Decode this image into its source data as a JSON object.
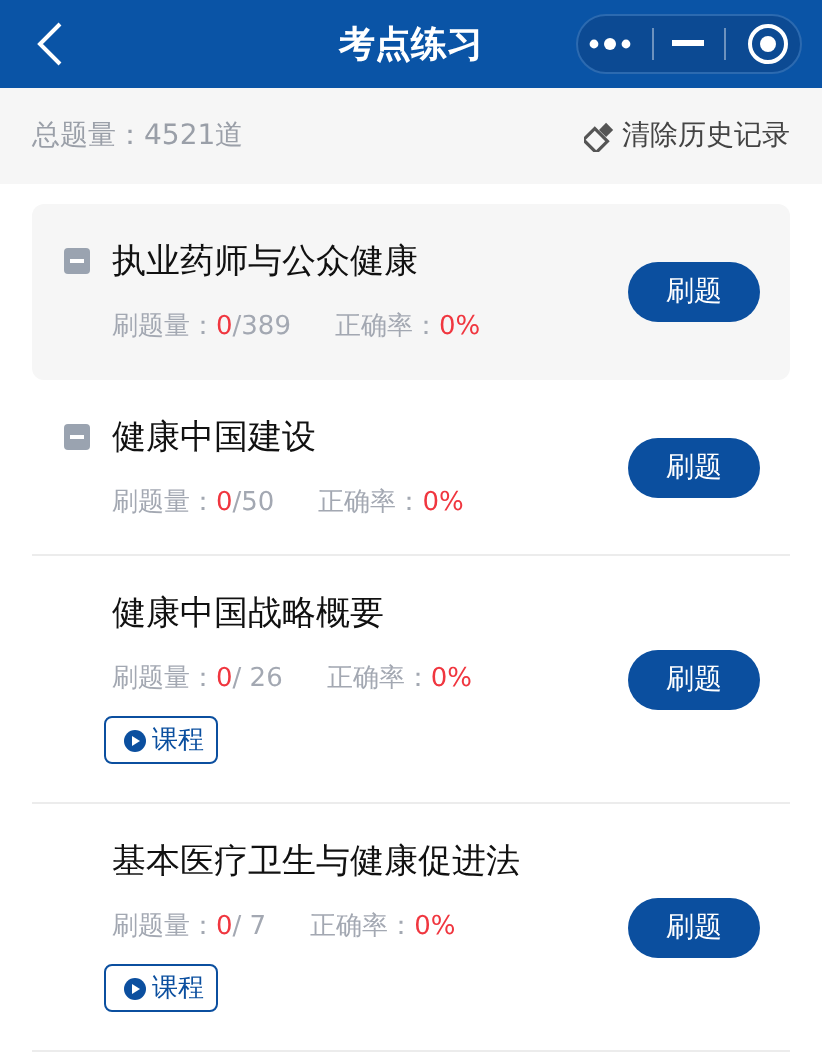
{
  "header": {
    "title": "考点练习"
  },
  "summary": {
    "total": "总题量：4521道",
    "clear_label": "清除历史记录"
  },
  "items": [
    {
      "kind": "chapter",
      "expanded": true,
      "selected": true,
      "title": "执业药师与公众健康",
      "done_label": "刷题量：",
      "done": "0",
      "total": "/389",
      "accuracy_label": "正确率：",
      "accuracy": "0%",
      "button": "刷题"
    },
    {
      "kind": "chapter",
      "expanded": true,
      "selected": false,
      "title": "健康中国建设",
      "done_label": "刷题量：",
      "done": "0",
      "total": "/50",
      "accuracy_label": "正确率：",
      "accuracy": "0%",
      "button": "刷题"
    },
    {
      "kind": "section",
      "selected": false,
      "title": "健康中国战略概要",
      "done_label": "刷题量：",
      "done": "0",
      "total": "/ 26",
      "accuracy_label": "正确率：",
      "accuracy": "0%",
      "button": "刷题",
      "course": "课程"
    },
    {
      "kind": "section",
      "selected": false,
      "title": "基本医疗卫生与健康促进法",
      "done_label": "刷题量：",
      "done": "0",
      "total": "/ 7",
      "accuracy_label": "正确率：",
      "accuracy": "0%",
      "button": "刷题",
      "course": "课程"
    }
  ]
}
